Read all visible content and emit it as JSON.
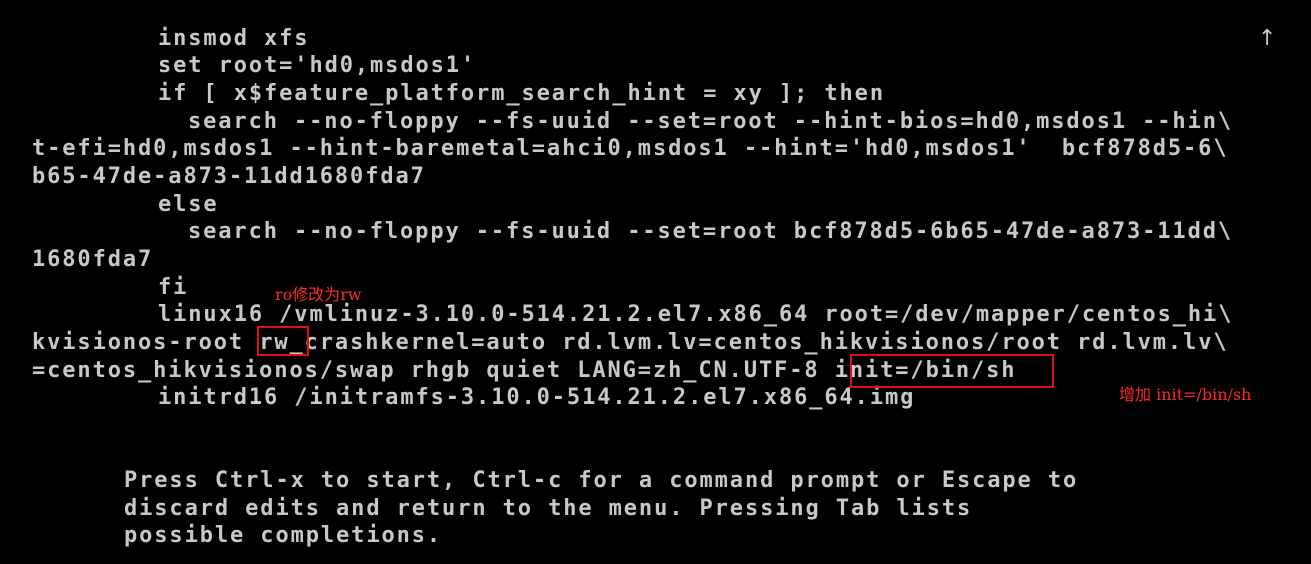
{
  "editor": {
    "lines": [
      "insmod xfs",
      "set root='hd0,msdos1'",
      "if [ x$feature_platform_search_hint = xy ]; then",
      "search --no-floppy --fs-uuid --set=root --hint-bios=hd0,msdos1 --hin\\",
      "t-efi=hd0,msdos1 --hint-baremetal=ahci0,msdos1 --hint='hd0,msdos1'  bcf878d5-6\\",
      "b65-47de-a873-11dd1680fda7",
      "else",
      "search --no-floppy --fs-uuid --set=root bcf878d5-6b65-47de-a873-11dd\\",
      "1680fda7",
      "fi",
      "linux16 /vmlinuz-3.10.0-514.21.2.el7.x86_64 root=/dev/mapper/centos_hi\\",
      "crashkernel=auto rd.lvm.lv=centos_hikvisionos/root rd.lvm.lv\\",
      "=centos_hikvisionos/swap rhgb quiet LANG=zh_CN.UTF-8 ",
      "initrd16 /initramfs-3.10.0-514.21.2.el7.x86_64.img"
    ],
    "line12_prefix": "kvisionos-root ",
    "rw_token": "rw",
    "init_token": "init=/bin/sh",
    "scroll_indicator": "↑"
  },
  "help": {
    "line1": "Press Ctrl-x to start, Ctrl-c for a command prompt or Escape to",
    "line2": "discard edits and return to the menu. Pressing Tab lists",
    "line3": "possible completions."
  },
  "annotations": {
    "rw_note": "ro修改为rw",
    "init_note": "增加 init=/bin/sh",
    "accent_color": "#e01010"
  }
}
